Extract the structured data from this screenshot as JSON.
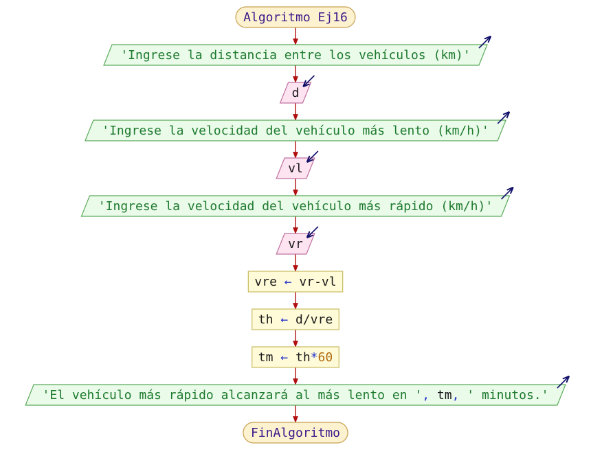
{
  "algorithm": {
    "start_label": "Algoritmo Ej16",
    "end_label": "FinAlgoritmo"
  },
  "steps": [
    {
      "type": "output",
      "parts": [
        {
          "text": "'Ingrese la distancia entre los vehículos (km)'",
          "role": "str"
        }
      ]
    },
    {
      "type": "input",
      "parts": [
        {
          "text": "d",
          "role": "var"
        }
      ]
    },
    {
      "type": "output",
      "parts": [
        {
          "text": "'Ingrese la velocidad del vehículo más lento (km/h)'",
          "role": "str"
        }
      ]
    },
    {
      "type": "input",
      "parts": [
        {
          "text": "vl",
          "role": "var"
        }
      ]
    },
    {
      "type": "output",
      "parts": [
        {
          "text": "'Ingrese la velocidad del vehículo más rápido (km/h)'",
          "role": "str"
        }
      ]
    },
    {
      "type": "input",
      "parts": [
        {
          "text": "vr",
          "role": "var"
        }
      ]
    },
    {
      "type": "process",
      "parts": [
        {
          "text": "vre",
          "role": "var"
        },
        {
          "text": " ← ",
          "role": "op"
        },
        {
          "text": "vr-vl",
          "role": "var"
        }
      ]
    },
    {
      "type": "process",
      "parts": [
        {
          "text": "th",
          "role": "var"
        },
        {
          "text": " ← ",
          "role": "op"
        },
        {
          "text": "d/vre",
          "role": "var"
        }
      ]
    },
    {
      "type": "process",
      "parts": [
        {
          "text": "tm",
          "role": "var"
        },
        {
          "text": " ← ",
          "role": "op"
        },
        {
          "text": "th",
          "role": "var"
        },
        {
          "text": "*",
          "role": "op"
        },
        {
          "text": "60",
          "role": "num"
        }
      ]
    },
    {
      "type": "output",
      "parts": [
        {
          "text": "'El vehículo más rápido alcanzará al más lento en '",
          "role": "str"
        },
        {
          "text": ", ",
          "role": "op"
        },
        {
          "text": "tm",
          "role": "var"
        },
        {
          "text": ", ",
          "role": "op"
        },
        {
          "text": "' minutos.'",
          "role": "str"
        }
      ]
    }
  ],
  "colors": {
    "terminal_fill": "#fdf2d0",
    "terminal_stroke": "#c8a050",
    "output_fill": "#eafbea",
    "output_stroke": "#5aaa5a",
    "input_fill": "#fde4f0",
    "input_stroke": "#c070a0",
    "process_fill": "#fffbd8",
    "process_stroke": "#c8bb60",
    "connector": "#b01010",
    "io_arrow": "#10106a"
  }
}
